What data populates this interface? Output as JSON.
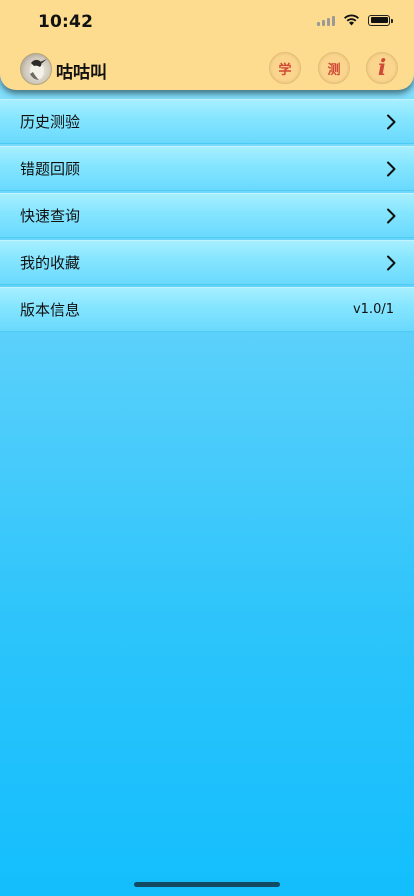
{
  "status_bar": {
    "time": "10:42"
  },
  "header": {
    "title": "咕咕叫",
    "buttons": [
      {
        "label": "学"
      },
      {
        "label": "测"
      },
      {
        "label": "i"
      }
    ]
  },
  "menu": {
    "items": [
      {
        "label": "历史测验"
      },
      {
        "label": "错题回顾"
      },
      {
        "label": "快速查询"
      },
      {
        "label": "我的收藏"
      },
      {
        "label": "版本信息",
        "value": "v1.0/1"
      }
    ]
  },
  "colors": {
    "header_bg": "#fedc8f",
    "accent_text": "#d04a35",
    "row_bg": "#87e6ff",
    "page_bottom": "#13befd"
  }
}
